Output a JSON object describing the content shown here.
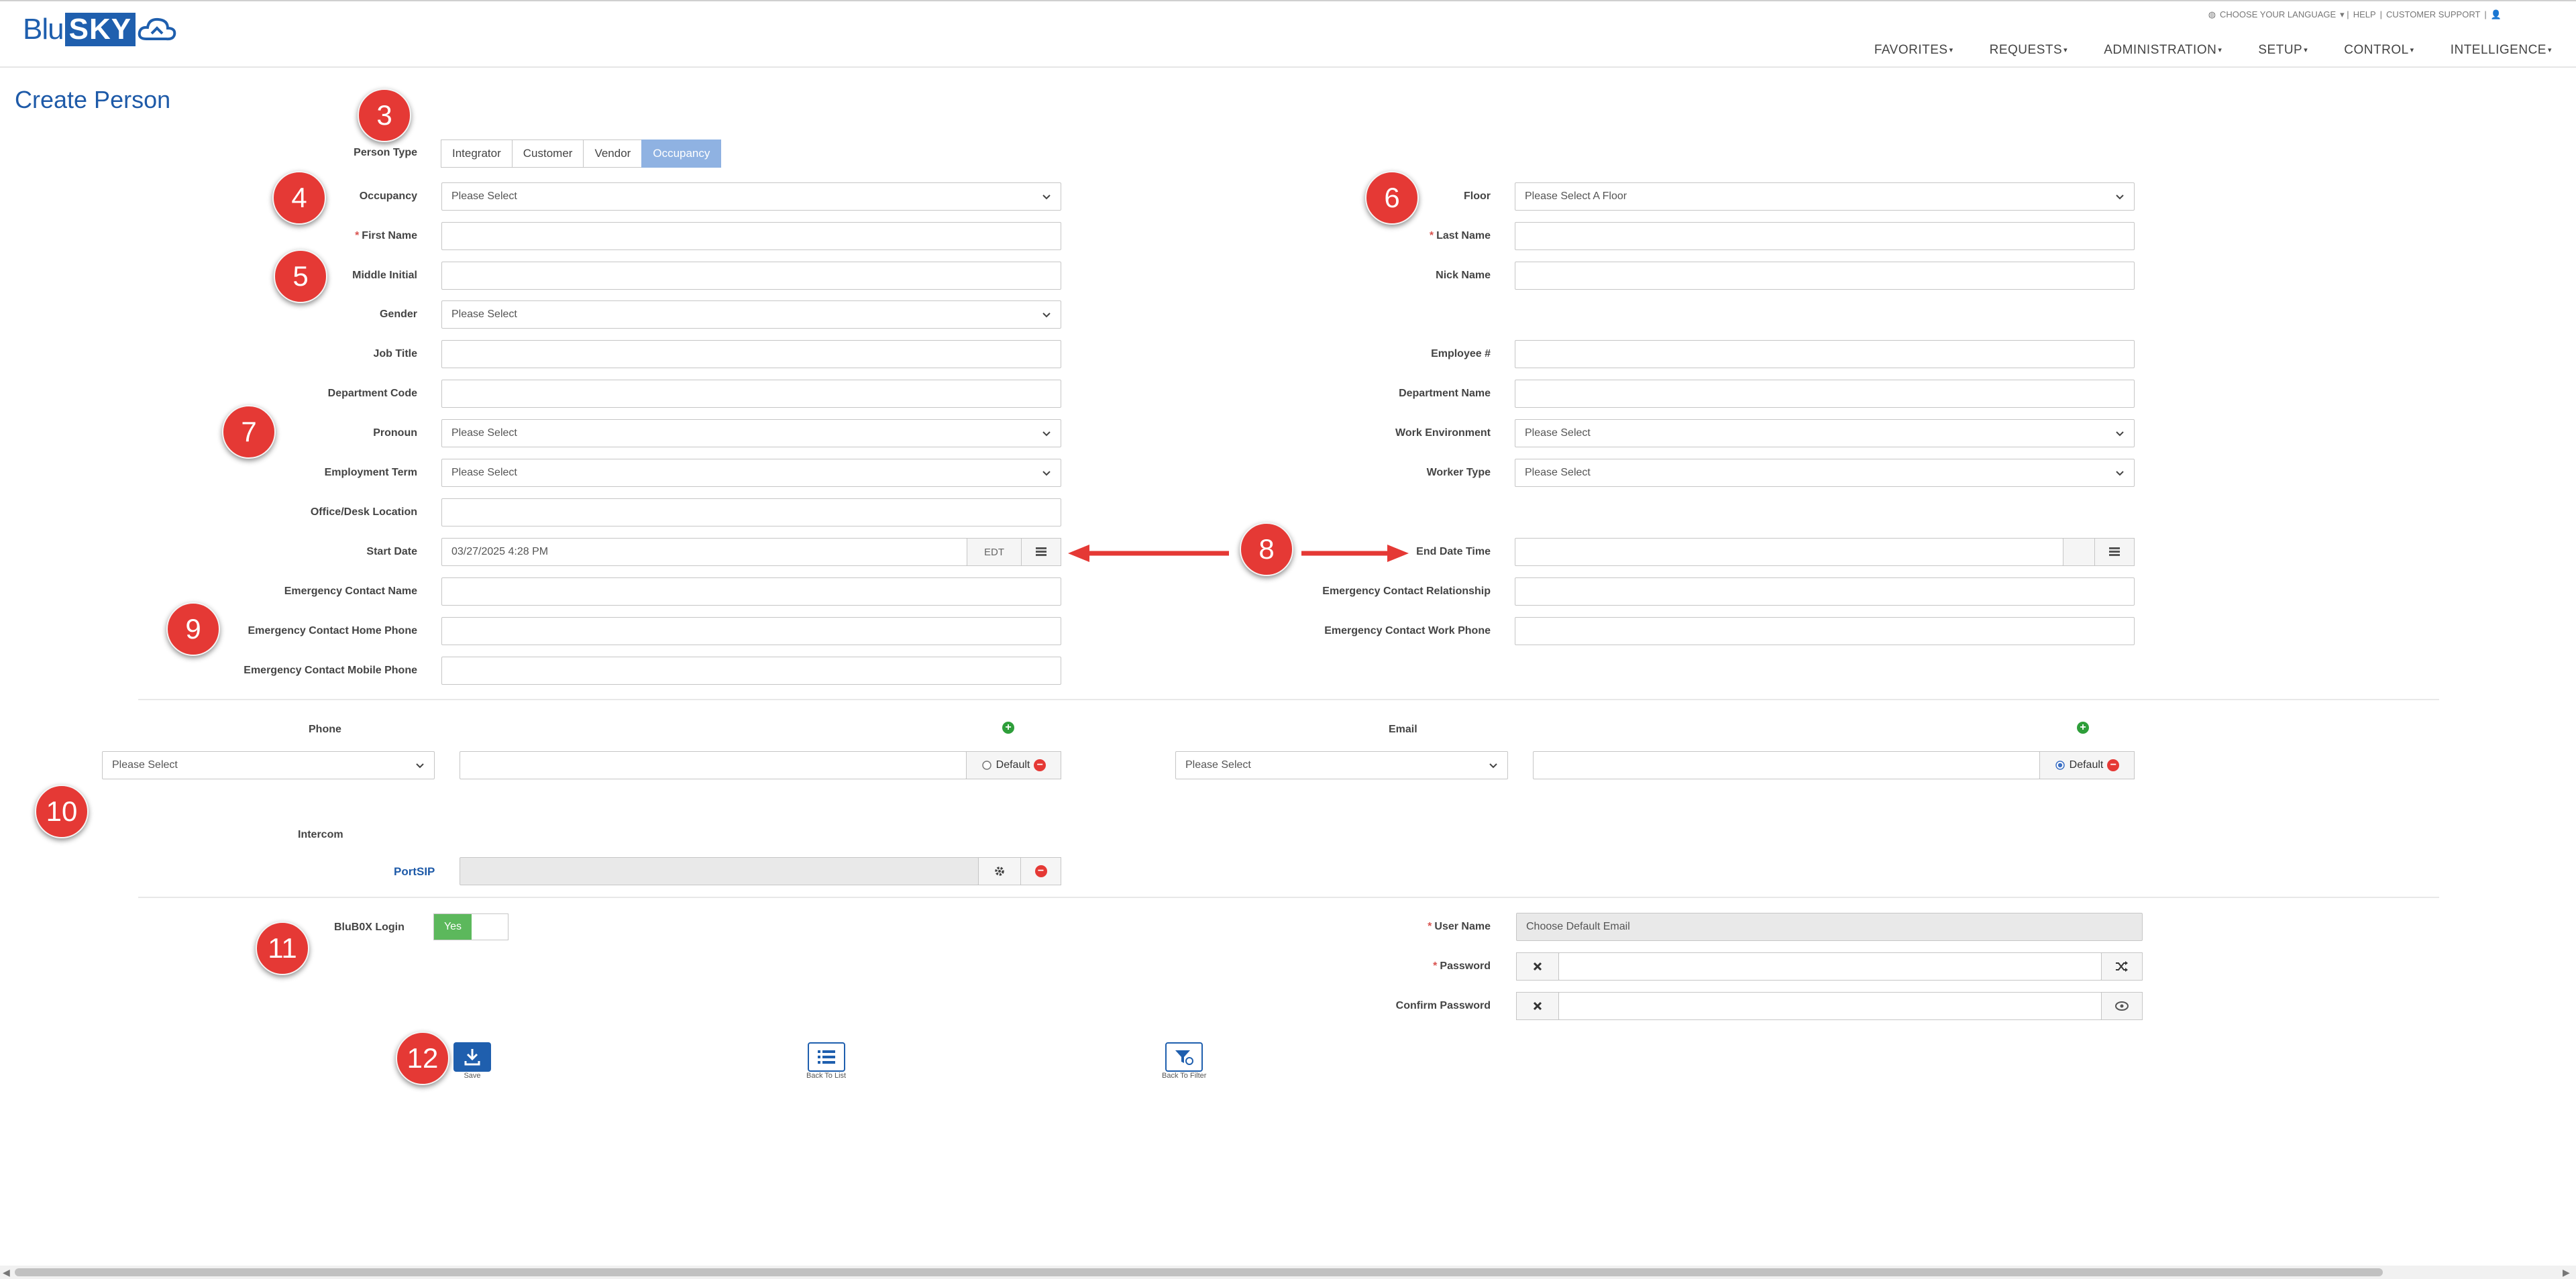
{
  "header": {
    "logo_blu": "Blu",
    "logo_sky": "SKY",
    "toplinks": {
      "language": "CHOOSE YOUR LANGUAGE",
      "help": "HELP",
      "support": "CUSTOMER SUPPORT"
    },
    "nav": [
      "FAVORITES",
      "REQUESTS",
      "ADMINISTRATION",
      "SETUP",
      "CONTROL",
      "INTELLIGENCE"
    ]
  },
  "page": {
    "title": "Create Person"
  },
  "annotations": [
    "3",
    "4",
    "5",
    "6",
    "7",
    "8",
    "9",
    "10",
    "11",
    "12"
  ],
  "person_type": {
    "label": "Person Type",
    "options": [
      "Integrator",
      "Customer",
      "Vendor",
      "Occupancy"
    ],
    "selected": "Occupancy"
  },
  "left_fields": {
    "occupancy": {
      "label": "Occupancy",
      "value": "Please Select"
    },
    "first_name": {
      "label": "First Name",
      "required": "*"
    },
    "middle_initial": {
      "label": "Middle Initial"
    },
    "gender": {
      "label": "Gender",
      "value": "Please Select"
    },
    "job_title": {
      "label": "Job Title"
    },
    "department_code": {
      "label": "Department Code"
    },
    "pronoun": {
      "label": "Pronoun",
      "value": "Please Select"
    },
    "employment_term": {
      "label": "Employment Term",
      "value": "Please Select"
    },
    "office_desk": {
      "label": "Office/Desk Location"
    },
    "start_date": {
      "label": "Start Date",
      "value": "03/27/2025 4:28 PM",
      "tz": "EDT"
    },
    "ec_name": {
      "label": "Emergency Contact Name"
    },
    "ec_home": {
      "label": "Emergency Contact Home Phone"
    },
    "ec_mobile": {
      "label": "Emergency Contact Mobile Phone"
    }
  },
  "right_fields": {
    "floor": {
      "label": "Floor",
      "value": "Please Select A Floor"
    },
    "last_name": {
      "label": "Last Name",
      "required": "*"
    },
    "nick_name": {
      "label": "Nick Name"
    },
    "employee_no": {
      "label": "Employee #"
    },
    "department_name": {
      "label": "Department Name"
    },
    "work_environment": {
      "label": "Work Environment",
      "value": "Please Select"
    },
    "worker_type": {
      "label": "Worker Type",
      "value": "Please Select"
    },
    "end_date": {
      "label": "End Date Time"
    },
    "ec_relationship": {
      "label": "Emergency Contact Relationship"
    },
    "ec_work": {
      "label": "Emergency Contact Work Phone"
    }
  },
  "phone": {
    "label": "Phone",
    "type_value": "Please Select",
    "default_label": "Default",
    "default_checked": false
  },
  "email": {
    "label": "Email",
    "type_value": "Please Select",
    "default_label": "Default",
    "default_checked": true
  },
  "intercom": {
    "label": "Intercom",
    "link": "PortSIP"
  },
  "login": {
    "label": "BluB0X Login",
    "toggle": "Yes",
    "username_label": "User Name",
    "username_value": "Choose Default Email",
    "password_label": "Password",
    "confirm_label": "Confirm Password",
    "required": "*"
  },
  "actions": {
    "save": "Save",
    "back_list": "Back To List",
    "back_filter": "Back To Filter"
  },
  "colors": {
    "brand": "#1f5fae",
    "badge": "#e53935",
    "active_tab": "#8fb2e2",
    "toggle_on": "#5cb85c"
  }
}
